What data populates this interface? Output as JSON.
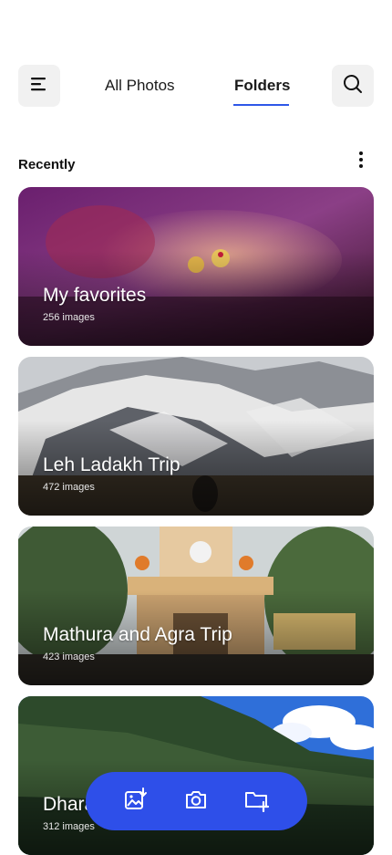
{
  "header": {
    "menu_icon": "menu-icon",
    "search_icon": "search-icon",
    "tabs": [
      {
        "label": "All Photos",
        "active": false
      },
      {
        "label": "Folders",
        "active": true
      }
    ],
    "accent_color": "#2e57e8"
  },
  "section": {
    "title": "Recently",
    "more_icon": "more-vertical-icon"
  },
  "folders": [
    {
      "title": "My favorites",
      "count": "256 images"
    },
    {
      "title": "Leh Ladakh Trip",
      "count": "472 images"
    },
    {
      "title": "Mathura and Agra Trip",
      "count": "423 images"
    },
    {
      "title": "Dharamshala Trip",
      "count": "312 images"
    }
  ],
  "bottom_bar": {
    "color": "#2e4fe9",
    "actions": [
      "import-image-icon",
      "camera-icon",
      "new-folder-icon"
    ]
  }
}
